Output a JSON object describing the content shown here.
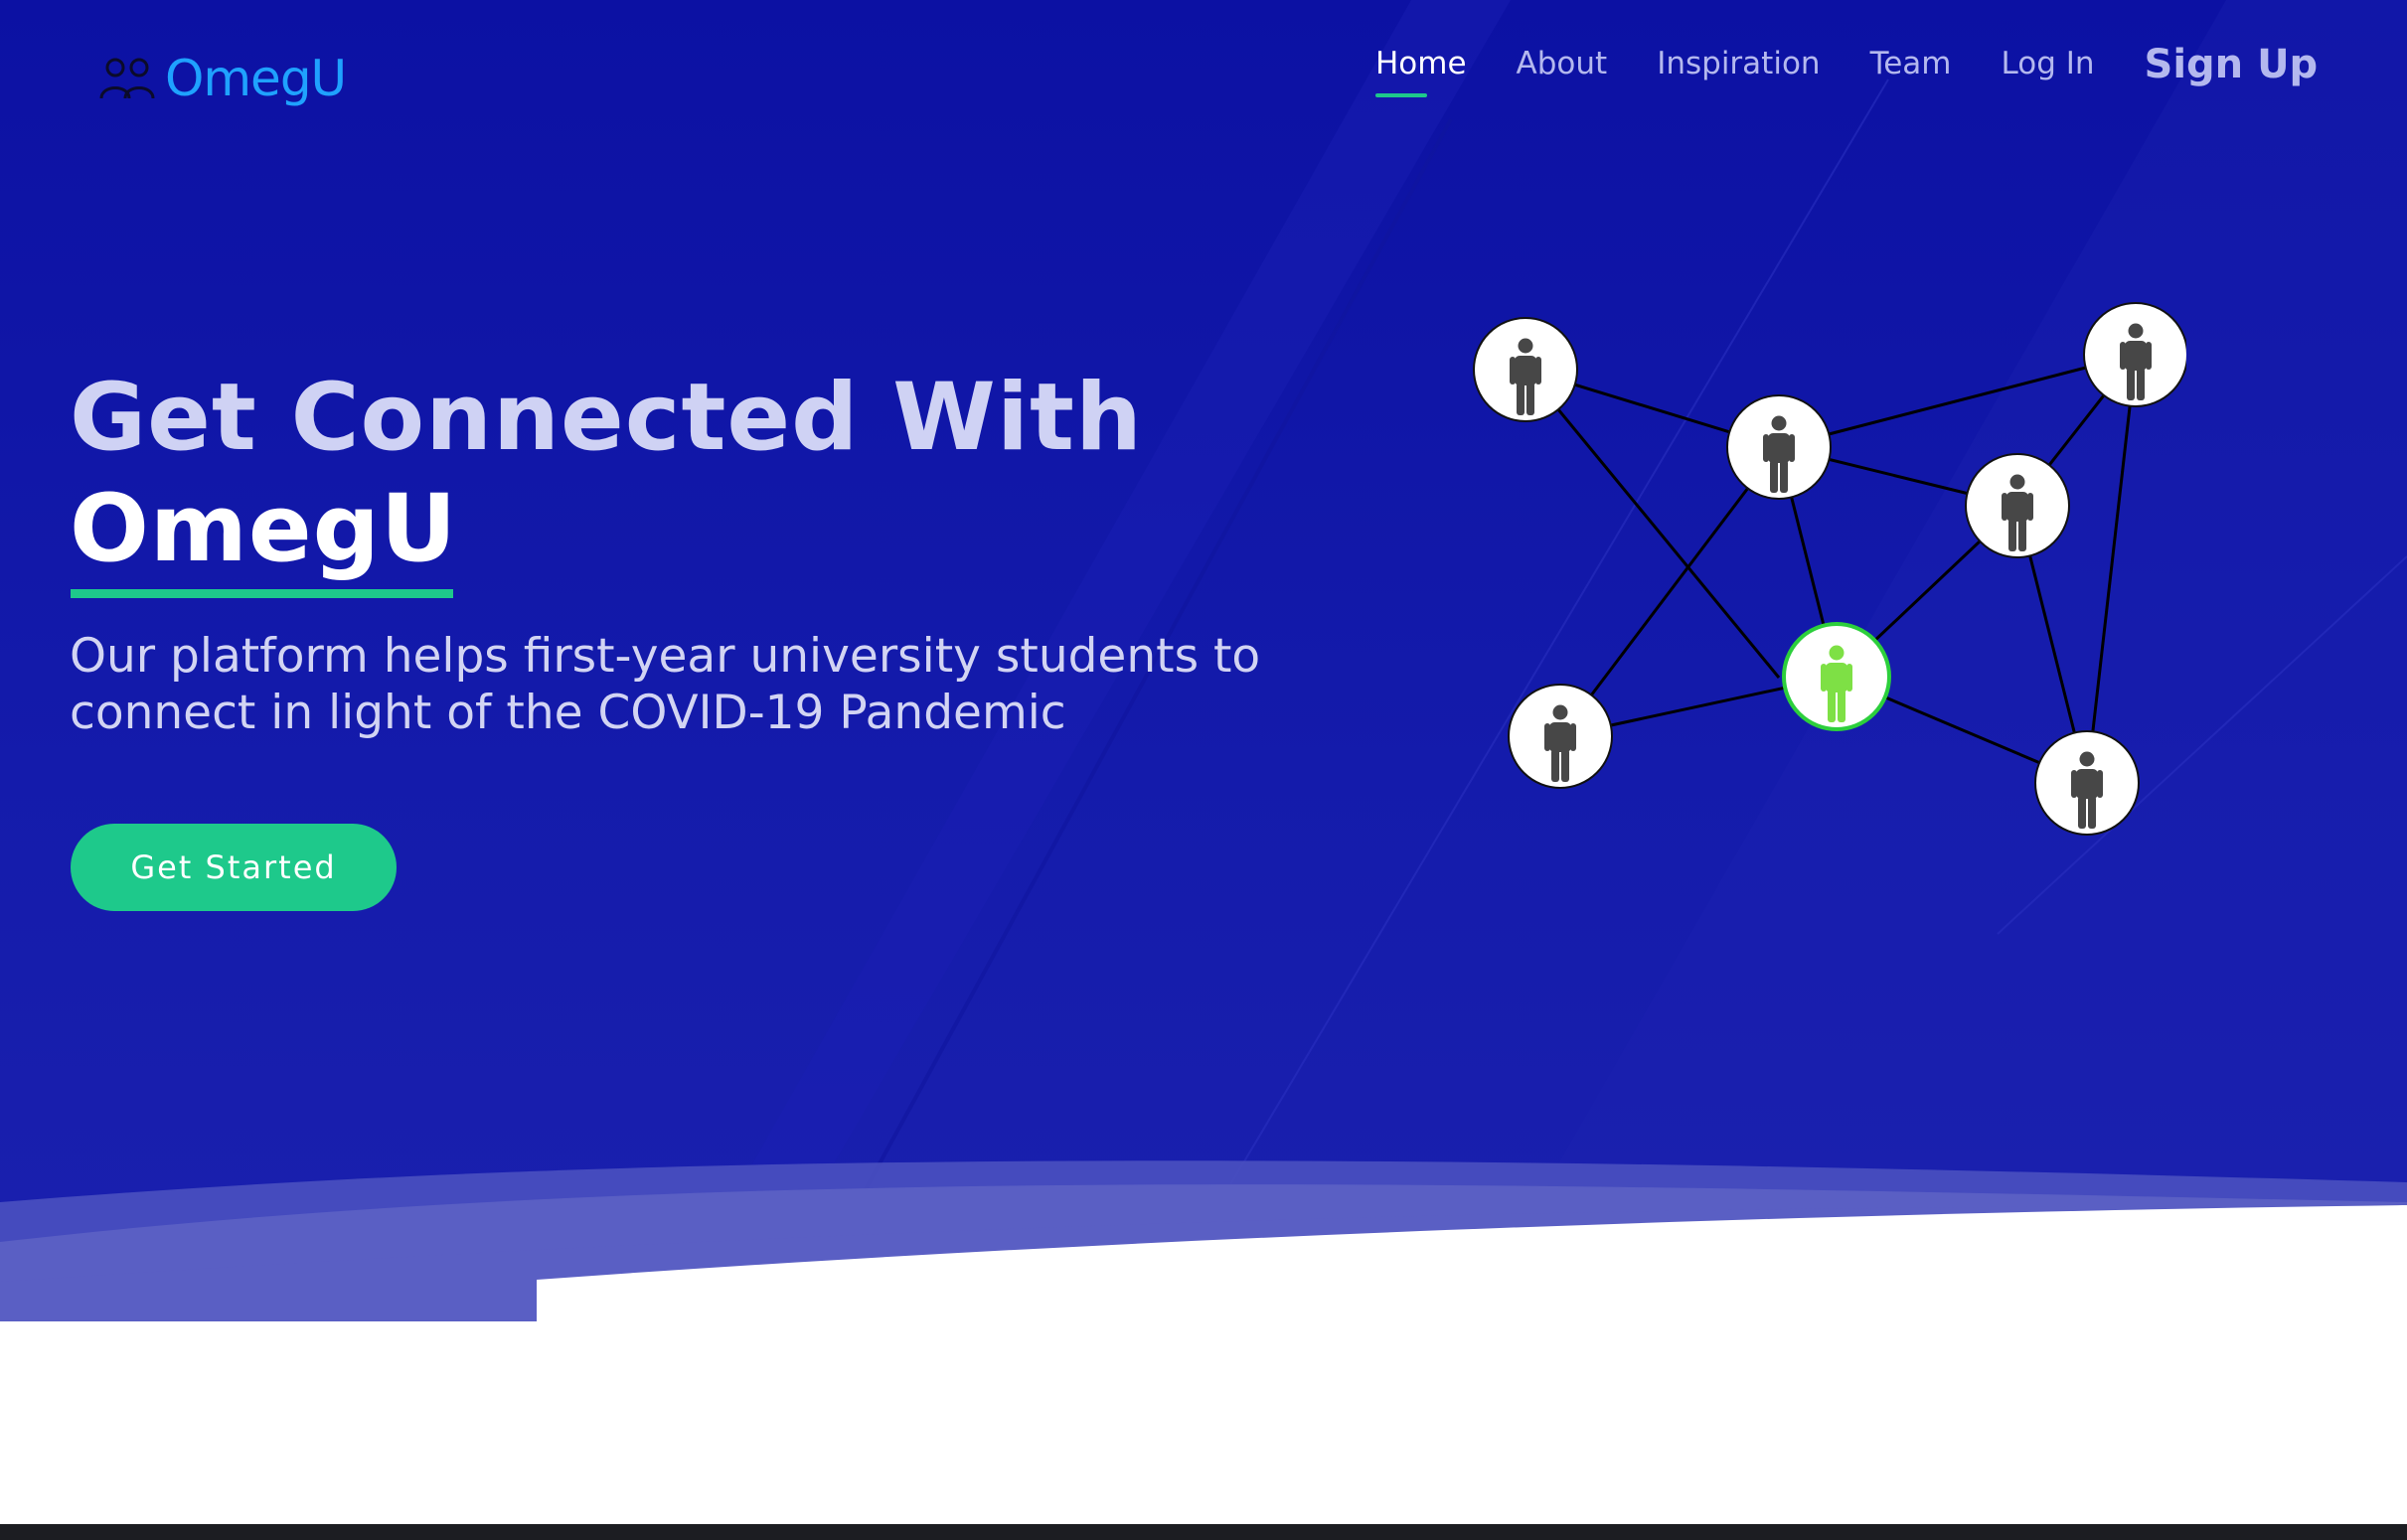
{
  "brand": {
    "name": "OmegU",
    "icon": "users-icon",
    "color": "#1fa2ff"
  },
  "nav": {
    "items": [
      {
        "label": "Home",
        "active": true
      },
      {
        "label": "About",
        "active": false
      },
      {
        "label": "Inspiration",
        "active": false
      },
      {
        "label": "Team",
        "active": false
      },
      {
        "label": "Log In",
        "active": false
      }
    ],
    "signup_label": "Sign Up"
  },
  "hero": {
    "headline_line1": "Get Connected With",
    "headline_brand": "OmegU",
    "subtitle": "Our platform helps first-year university students to connect in light of the COVID-19 Pandemic",
    "cta_label": "Get Started",
    "illustration": "people-network-icon"
  },
  "colors": {
    "hero_background": "#0c11a3",
    "accent": "#1ec98b",
    "highlight_person": "#7ee045",
    "person": "#474747",
    "wave": "#5a5fc4"
  }
}
